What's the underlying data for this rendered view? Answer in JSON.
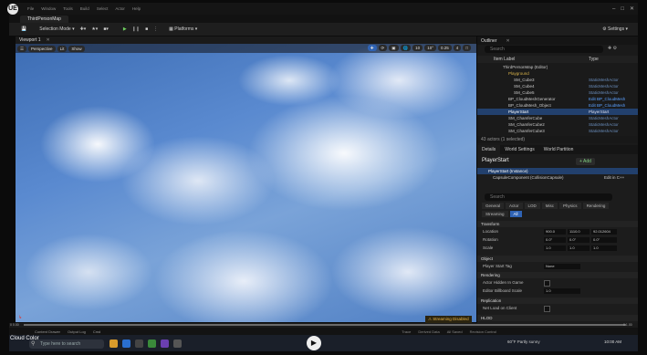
{
  "app": {
    "logo": "UE",
    "menu": [
      "File",
      "Window",
      "Tools",
      "Build",
      "Select",
      "Actor",
      "Help"
    ],
    "project": "ThirdPersonMap"
  },
  "toolbar": {
    "mode": "Selection Mode",
    "platforms": "Platforms",
    "settings": "Settings"
  },
  "viewport": {
    "tab": "Viewport 1",
    "perspective": "Perspective",
    "lit": "Lit",
    "show": "Show",
    "snap_values": [
      "10",
      "10°",
      "0.25"
    ],
    "camera_speed": "4",
    "streaming_warning": "Streaming Disabled"
  },
  "outliner": {
    "tab": "Outliner",
    "search_placeholder": "Search",
    "col_label": "Item Label",
    "col_type": "Type",
    "rows": [
      {
        "name": "ThirdPersonMap (Editor)",
        "type": ""
      },
      {
        "name": "Playground",
        "type": ""
      },
      {
        "name": "SM_Cube3",
        "type": "StaticMeshActor"
      },
      {
        "name": "SM_Cube4",
        "type": "StaticMeshActor"
      },
      {
        "name": "SM_Cube5",
        "type": "StaticMeshActor"
      },
      {
        "name": "BP_CloudMeshGenerator",
        "type": "Edit BP_CloudMesh"
      },
      {
        "name": "BP_CloudMesh_Object",
        "type": "Edit BP_CloudMesh"
      },
      {
        "name": "PlayerStart",
        "type": "PlayerStart"
      },
      {
        "name": "SM_ChamferCube",
        "type": "StaticMeshActor"
      },
      {
        "name": "SM_ChamferCube2",
        "type": "StaticMeshActor"
      },
      {
        "name": "SM_ChamferCube3",
        "type": "StaticMeshActor"
      }
    ],
    "footer": "43 actors (1 selected)"
  },
  "details": {
    "tabs": [
      "Details",
      "World Settings",
      "World Partition"
    ],
    "actor": "PlayerStart",
    "add": "+ Add",
    "instance": "PlayerStart (Instance)",
    "component": "CapsuleComponent (CollisionCapsule)",
    "edit_cpp": "Edit in C++",
    "search_placeholder": "Search",
    "filter_tabs": [
      "General",
      "Actor",
      "LOD",
      "Misc",
      "Physics",
      "Rendering",
      "Streaming",
      "All"
    ],
    "transform": {
      "header": "Transform",
      "location_label": "Location",
      "rotation_label": "Rotation",
      "scale_label": "Scale",
      "location": [
        "900.0",
        "1110.0",
        "92.012604"
      ],
      "rotation": [
        "0.0°",
        "0.0°",
        "0.0°"
      ],
      "scale": [
        "1.0",
        "1.0",
        "1.0"
      ]
    },
    "object": {
      "header": "Object",
      "tag_label": "Player Start Tag",
      "tag_value": "None"
    },
    "rendering": {
      "header": "Rendering",
      "hidden_label": "Actor Hidden In Game",
      "billboard_label": "Editor Billboard Scale",
      "billboard_value": "1.0"
    },
    "replication": {
      "header": "Replication",
      "net_label": "Net Load on Client"
    },
    "hlod": {
      "header": "HLOD"
    }
  },
  "timeline": {
    "start": "0 0.00",
    "end": "0 1.00"
  },
  "content_bar": {
    "items": [
      "Content Drawer",
      "Output Log",
      "Cmd"
    ],
    "right": [
      "Trace",
      "Derived Data",
      "All Saved",
      "Revision Control"
    ]
  },
  "taskbar": {
    "tooltip": "Cloud Color",
    "search_placeholder": "Type here to search",
    "weather": "60°F Partly sunny",
    "time": "10:00 AM"
  },
  "colors": {
    "accent": "#2f63b4",
    "selected_row": "#22406d",
    "warning": "#e8b64a",
    "sky": "#4f7fc4"
  }
}
